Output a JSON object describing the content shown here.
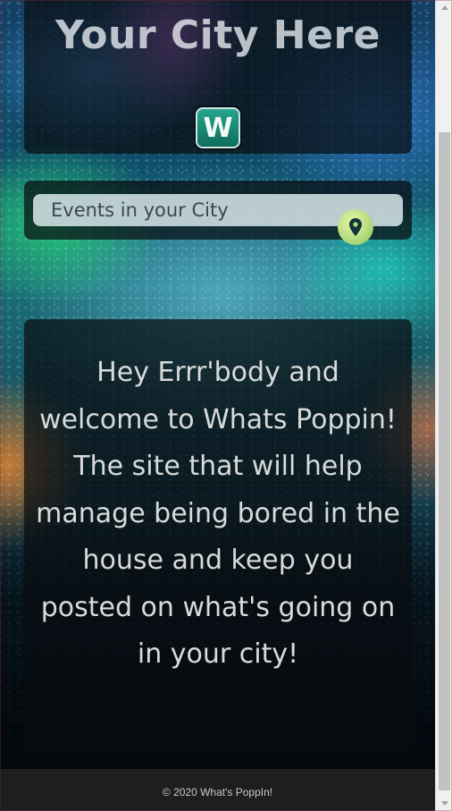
{
  "header": {
    "city_title": "Your City Here",
    "logo_letter": "W"
  },
  "search": {
    "placeholder": "Events in your City",
    "value": "",
    "location_icon": "map-pin-icon"
  },
  "welcome": {
    "message": "Hey Errr'body and welcome to Whats Poppin! The site that will help manage being bored in the house and keep you posted on what's going on in your city!"
  },
  "footer": {
    "copyright": "© 2020 What's PoppIn!"
  },
  "colors": {
    "panel_bg": "#0c1014",
    "logo_green": "#1f9a84",
    "location_button": "#b7dc7e",
    "text_light": "#d7dbd9",
    "footer_bg": "#1e1e1e"
  }
}
